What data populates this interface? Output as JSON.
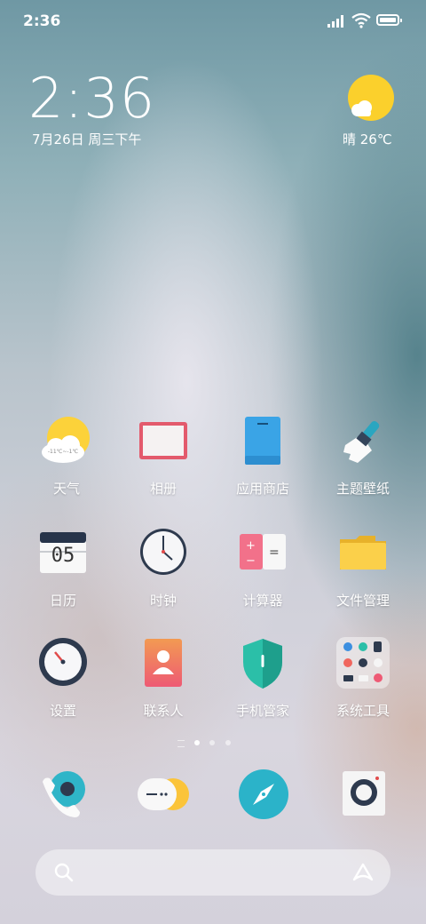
{
  "status_bar": {
    "time": "2:36"
  },
  "clock_widget": {
    "time": "2:36",
    "date": "7月26日 周三下午"
  },
  "weather_widget": {
    "text": "晴 26℃",
    "mini_icon_text": "-11℃~-1℃"
  },
  "apps": [
    {
      "label": "天气",
      "icon": "weather-icon"
    },
    {
      "label": "相册",
      "icon": "gallery-icon"
    },
    {
      "label": "应用商店",
      "icon": "app-store-icon"
    },
    {
      "label": "主题壁纸",
      "icon": "theme-brush-icon"
    },
    {
      "label": "日历",
      "icon": "calendar-icon",
      "icon_text": "05"
    },
    {
      "label": "时钟",
      "icon": "clock-icon"
    },
    {
      "label": "计算器",
      "icon": "calculator-icon"
    },
    {
      "label": "文件管理",
      "icon": "folder-icon"
    },
    {
      "label": "设置",
      "icon": "settings-gauge-icon"
    },
    {
      "label": "联系人",
      "icon": "contacts-icon"
    },
    {
      "label": "手机管家",
      "icon": "shield-icon"
    },
    {
      "label": "系统工具",
      "icon": "system-tools-folder-icon"
    }
  ],
  "page_indicator": {
    "pages": 3,
    "current": 1
  },
  "dock": [
    {
      "icon": "phone-icon"
    },
    {
      "icon": "messages-icon"
    },
    {
      "icon": "browser-compass-icon"
    },
    {
      "icon": "camera-icon"
    }
  ],
  "colors": {
    "sun": "#fbd02c",
    "teal": "#2fb5c8",
    "shield": "#2bbfa8",
    "folder": "#fbd04a"
  }
}
